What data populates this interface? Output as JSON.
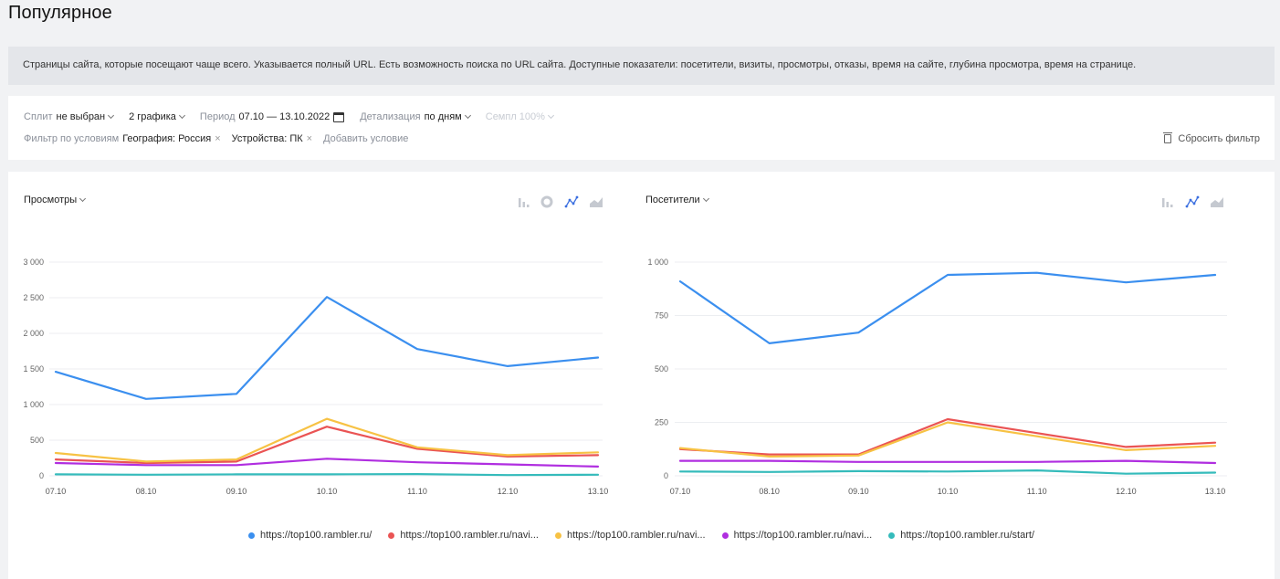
{
  "page": {
    "title": "Популярное"
  },
  "info": {
    "text": "Страницы сайта, которые посещают чаще всего. Указывается полный URL. Есть возможность поиска по URL сайта. Доступные показатели: посетители, визиты, просмотры, отказы, время на сайте, глубина просмотра, время на странице."
  },
  "filters": {
    "split_label": "Сплит",
    "split_value": "не выбран",
    "graphs_value": "2 графика",
    "period_label": "Период",
    "period_value": "07.10 — 13.10.2022",
    "detail_label": "Детализация",
    "detail_value": "по дням",
    "sample_label": "Семпл 100%",
    "conditions_label": "Фильтр по условиям",
    "chip_geo": "География: Россия",
    "chip_device": "Устройства: ПК",
    "chip_close": "×",
    "add_condition": "Добавить условие",
    "reset": "Сбросить фильтр"
  },
  "colors": {
    "blue": "#3b8fef",
    "red": "#ea5454",
    "yellow": "#f7c244",
    "purple": "#b02ee0",
    "teal": "#35bbbb",
    "active_icon": "#3b6fe0",
    "inactive_icon": "#c5c9d0"
  },
  "icons": {
    "left": [
      "bar-chart-icon",
      "pie-chart-icon",
      "line-chart-icon",
      "area-chart-icon"
    ],
    "right": [
      "bar-chart-icon",
      "line-chart-icon",
      "area-chart-icon"
    ]
  },
  "legend": [
    {
      "label": "https://top100.rambler.ru/",
      "color": "#3b8fef"
    },
    {
      "label": "https://top100.rambler.ru/navi...",
      "color": "#ea5454"
    },
    {
      "label": "https://top100.rambler.ru/navi...",
      "color": "#f7c244"
    },
    {
      "label": "https://top100.rambler.ru/navi...",
      "color": "#b02ee0"
    },
    {
      "label": "https://top100.rambler.ru/start/",
      "color": "#35bbbb"
    }
  ],
  "chart_data": [
    {
      "type": "line",
      "title": "Просмотры",
      "categories": [
        "07.10",
        "08.10",
        "09.10",
        "10.10",
        "11.10",
        "12.10",
        "13.10"
      ],
      "ylim": [
        0,
        3000
      ],
      "yticks": [
        0,
        500,
        1000,
        1500,
        2000,
        2500,
        3000
      ],
      "ytick_labels": [
        "0",
        "500",
        "1 000",
        "1 500",
        "2 000",
        "2 500",
        "3 000"
      ],
      "grid": true,
      "series": [
        {
          "name": "https://top100.rambler.ru/",
          "color": "#3b8fef",
          "values": [
            1460,
            1080,
            1150,
            2510,
            1780,
            1540,
            1660
          ]
        },
        {
          "name": "https://top100.rambler.ru/navi...",
          "color": "#ea5454",
          "values": [
            230,
            180,
            200,
            690,
            380,
            270,
            290
          ]
        },
        {
          "name": "https://top100.rambler.ru/navi...",
          "color": "#f7c244",
          "values": [
            320,
            200,
            230,
            800,
            400,
            290,
            330
          ]
        },
        {
          "name": "https://top100.rambler.ru/navi...",
          "color": "#b02ee0",
          "values": [
            180,
            150,
            150,
            240,
            190,
            160,
            130
          ]
        },
        {
          "name": "https://top100.rambler.ru/start/",
          "color": "#35bbbb",
          "values": [
            20,
            15,
            20,
            20,
            25,
            10,
            15
          ]
        }
      ]
    },
    {
      "type": "line",
      "title": "Посетители",
      "categories": [
        "07.10",
        "08.10",
        "09.10",
        "10.10",
        "11.10",
        "12.10",
        "13.10"
      ],
      "ylim": [
        0,
        1000
      ],
      "yticks": [
        0,
        250,
        500,
        750,
        1000
      ],
      "ytick_labels": [
        "0",
        "250",
        "500",
        "750",
        "1 000"
      ],
      "grid": true,
      "series": [
        {
          "name": "https://top100.rambler.ru/",
          "color": "#3b8fef",
          "values": [
            910,
            620,
            670,
            940,
            950,
            905,
            940
          ]
        },
        {
          "name": "https://top100.rambler.ru/navi...",
          "color": "#ea5454",
          "values": [
            125,
            100,
            100,
            265,
            200,
            135,
            155
          ]
        },
        {
          "name": "https://top100.rambler.ru/navi...",
          "color": "#f7c244",
          "values": [
            130,
            90,
            95,
            250,
            185,
            120,
            140
          ]
        },
        {
          "name": "https://top100.rambler.ru/navi...",
          "color": "#b02ee0",
          "values": [
            70,
            70,
            65,
            65,
            65,
            70,
            60
          ]
        },
        {
          "name": "https://top100.rambler.ru/start/",
          "color": "#35bbbb",
          "values": [
            20,
            18,
            22,
            20,
            25,
            10,
            15
          ]
        }
      ]
    }
  ]
}
